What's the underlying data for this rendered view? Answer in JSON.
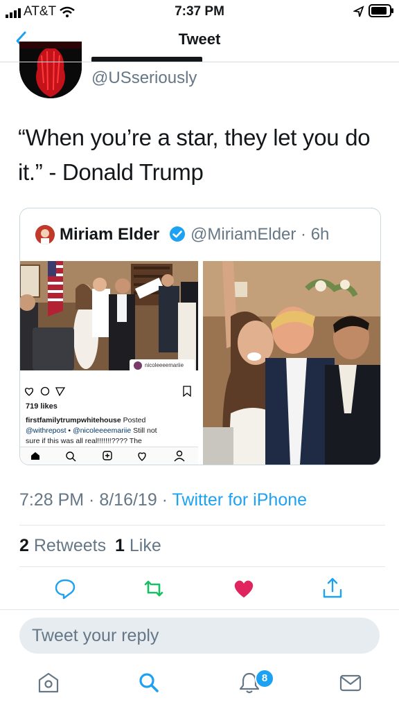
{
  "status_bar": {
    "carrier": "AT&T",
    "time": "7:37 PM"
  },
  "nav": {
    "title": "Tweet",
    "back_icon": "chevron-left-icon"
  },
  "tweet": {
    "handle": "@USseriously",
    "text": "“When you’re a star, they let you do it.” - Donald Trump",
    "timestamp": "7:28 PM · 8/16/19 · ",
    "source": "Twitter for iPhone",
    "retweets_count": "2",
    "retweets_label": "Retweets",
    "likes_count": "1",
    "likes_label": "Like"
  },
  "quote": {
    "name": "Miriam Elder",
    "handle": "@MiriamElder · 6h",
    "instagram": {
      "username": "nicoleeeemariie",
      "likes": "719 likes",
      "caption_user": "firstfamilytrumpwhitehouse",
      "caption_rest": " Posted",
      "caption_line2_a": "@withrepost",
      "caption_line2_b": " • ",
      "caption_line2_c": "@nicoleeeemariie",
      "caption_line2_d": " Still not",
      "caption_line3": "sure if this was all real!!!!!!!???? The"
    }
  },
  "reply": {
    "placeholder": "Tweet your reply"
  },
  "tabbar": {
    "notifications_badge": "8"
  },
  "colors": {
    "accent": "#1da1f2",
    "retweet": "#17bf63",
    "like": "#e0245e"
  }
}
